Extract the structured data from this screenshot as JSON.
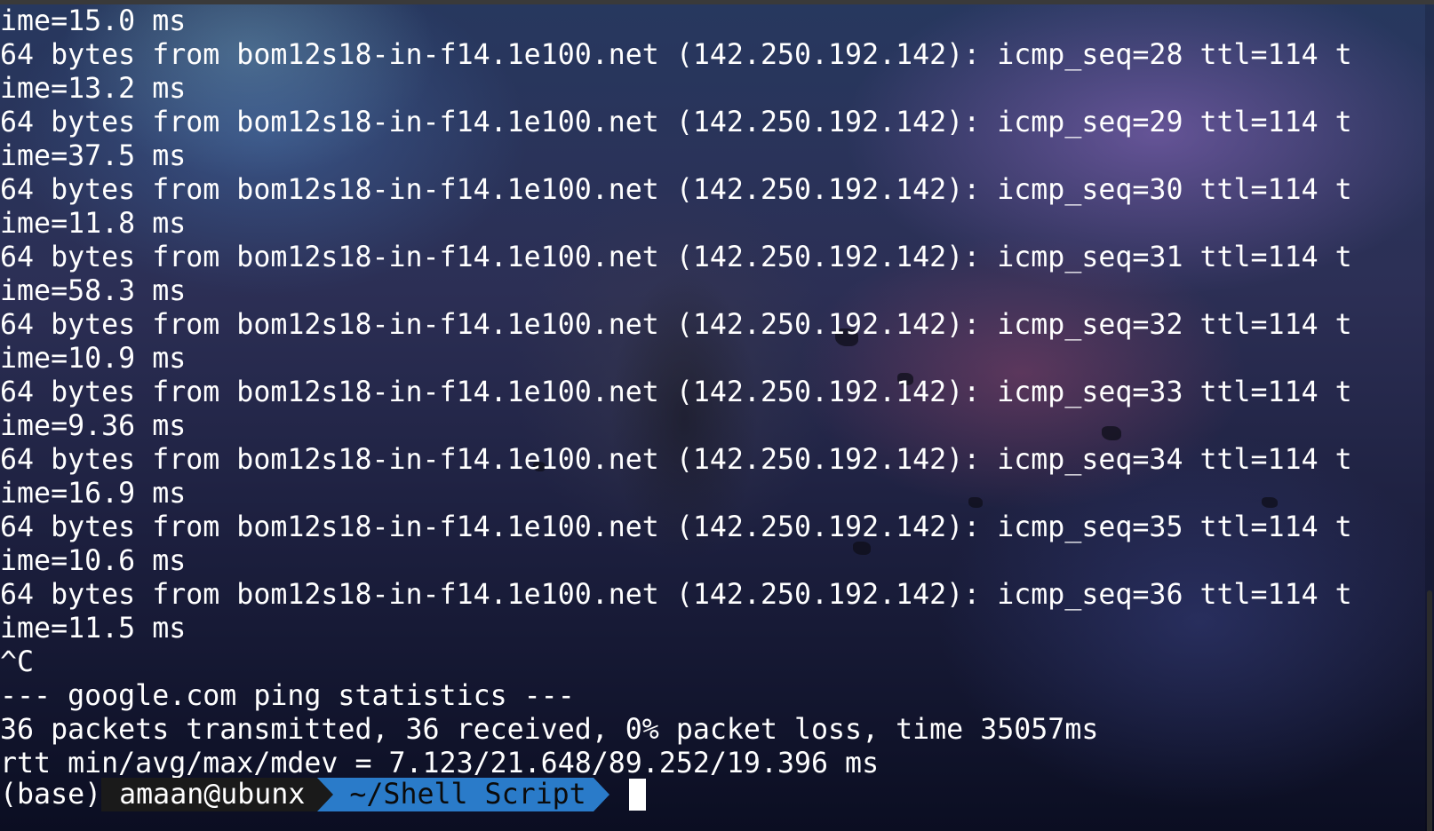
{
  "terminal": {
    "lines": [
      "ime=15.0 ms",
      "64 bytes from bom12s18-in-f14.1e100.net (142.250.192.142): icmp_seq=28 ttl=114 t",
      "ime=13.2 ms",
      "64 bytes from bom12s18-in-f14.1e100.net (142.250.192.142): icmp_seq=29 ttl=114 t",
      "ime=37.5 ms",
      "64 bytes from bom12s18-in-f14.1e100.net (142.250.192.142): icmp_seq=30 ttl=114 t",
      "ime=11.8 ms",
      "64 bytes from bom12s18-in-f14.1e100.net (142.250.192.142): icmp_seq=31 ttl=114 t",
      "ime=58.3 ms",
      "64 bytes from bom12s18-in-f14.1e100.net (142.250.192.142): icmp_seq=32 ttl=114 t",
      "ime=10.9 ms",
      "64 bytes from bom12s18-in-f14.1e100.net (142.250.192.142): icmp_seq=33 ttl=114 t",
      "ime=9.36 ms",
      "64 bytes from bom12s18-in-f14.1e100.net (142.250.192.142): icmp_seq=34 ttl=114 t",
      "ime=16.9 ms",
      "64 bytes from bom12s18-in-f14.1e100.net (142.250.192.142): icmp_seq=35 ttl=114 t",
      "ime=10.6 ms",
      "64 bytes from bom12s18-in-f14.1e100.net (142.250.192.142): icmp_seq=36 ttl=114 t",
      "ime=11.5 ms",
      "^C",
      "--- google.com ping statistics ---",
      "36 packets transmitted, 36 received, 0% packet loss, time 35057ms",
      "rtt min/avg/max/mdev = 7.123/21.648/89.252/19.396 ms"
    ],
    "prompt": {
      "env": "(base)",
      "user_host": "amaan@ubunx",
      "path": "~/Shell Script"
    }
  },
  "colors": {
    "text": "#ffffff",
    "prompt_user_bg": "#1a1a1a",
    "prompt_path_bg": "#2a7bc9",
    "cursor": "#ffffff"
  },
  "icons": {
    "prompt_separator": "powerline-arrow-icon"
  }
}
